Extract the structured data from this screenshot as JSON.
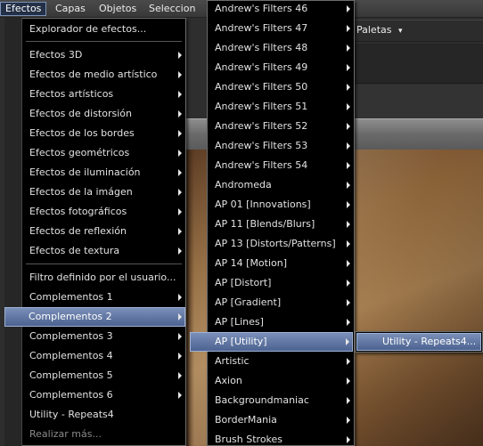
{
  "menubar": {
    "items": [
      {
        "label": "Efectos",
        "active": true
      },
      {
        "label": "Capas"
      },
      {
        "label": "Objetos"
      },
      {
        "label": "Seleccion"
      }
    ]
  },
  "toolbar": {
    "paletas_label": "Paletas",
    "paletas_arrow": "▾"
  },
  "efectos_menu": {
    "items": [
      {
        "label": "Explorador de efectos..."
      },
      {
        "label": "Efectos 3D"
      },
      {
        "label": "Efectos de medio artístico"
      },
      {
        "label": "Efectos artísticos"
      },
      {
        "label": "Efectos de distorsión"
      },
      {
        "label": "Efectos de los bordes"
      },
      {
        "label": "Efectos geométricos"
      },
      {
        "label": "Efectos de iluminación"
      },
      {
        "label": "Efectos de la imágen"
      },
      {
        "label": "Efectos fotográficos"
      },
      {
        "label": "Efectos de reflexión"
      },
      {
        "label": "Efectos de textura"
      },
      {
        "label": "Filtro definido por el usuario..."
      },
      {
        "label": "Complementos 1"
      },
      {
        "label": "Complementos 2"
      },
      {
        "label": "Complementos 3"
      },
      {
        "label": "Complementos 4"
      },
      {
        "label": "Complementos 5"
      },
      {
        "label": "Complementos 6"
      },
      {
        "label": "Utility - Repeats4"
      },
      {
        "label": "Realizar más..."
      }
    ]
  },
  "complementos_menu": {
    "items": [
      {
        "label": "Andrew's Filters 46"
      },
      {
        "label": "Andrew's Filters 47"
      },
      {
        "label": "Andrew's Filters 48"
      },
      {
        "label": "Andrew's Filters 49"
      },
      {
        "label": "Andrew's Filters 50"
      },
      {
        "label": "Andrew's Filters 51"
      },
      {
        "label": "Andrew's Filters 52"
      },
      {
        "label": "Andrew's Filters 53"
      },
      {
        "label": "Andrew's Filters 54"
      },
      {
        "label": "Andromeda"
      },
      {
        "label": "AP 01 [Innovations]"
      },
      {
        "label": "AP 11 [Blends/Blurs]"
      },
      {
        "label": "AP 13 [Distorts/Patterns]"
      },
      {
        "label": "AP 14 [Motion]"
      },
      {
        "label": "AP [Distort]"
      },
      {
        "label": "AP [Gradient]"
      },
      {
        "label": "AP [Lines]"
      },
      {
        "label": "AP [Utility]"
      },
      {
        "label": "Artistic"
      },
      {
        "label": "Axion"
      },
      {
        "label": "Backgroundmaniac"
      },
      {
        "label": "BorderMania"
      },
      {
        "label": "Brush Strokes"
      }
    ]
  },
  "utility_menu": {
    "items": [
      {
        "label": "Utility - Repeats4..."
      }
    ]
  },
  "colors": {
    "menu_bg": "#000000",
    "highlight": "#5f75a3",
    "canvas_brown": "#8a6238"
  }
}
